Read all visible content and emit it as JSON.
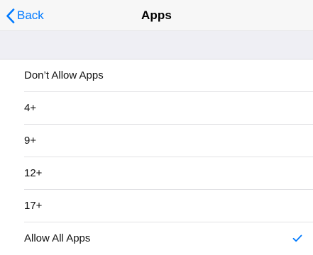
{
  "navbar": {
    "back_label": "Back",
    "title": "Apps"
  },
  "options": [
    {
      "label": "Don’t Allow Apps",
      "selected": false
    },
    {
      "label": "4+",
      "selected": false
    },
    {
      "label": "9+",
      "selected": false
    },
    {
      "label": "12+",
      "selected": false
    },
    {
      "label": "17+",
      "selected": false
    },
    {
      "label": "Allow All Apps",
      "selected": true
    }
  ],
  "colors": {
    "accent": "#007aff",
    "grouped_background": "#efeff4",
    "separator": "#e1e1e4"
  },
  "icons": {
    "back": "chevron-left-icon",
    "selected": "checkmark-icon"
  }
}
